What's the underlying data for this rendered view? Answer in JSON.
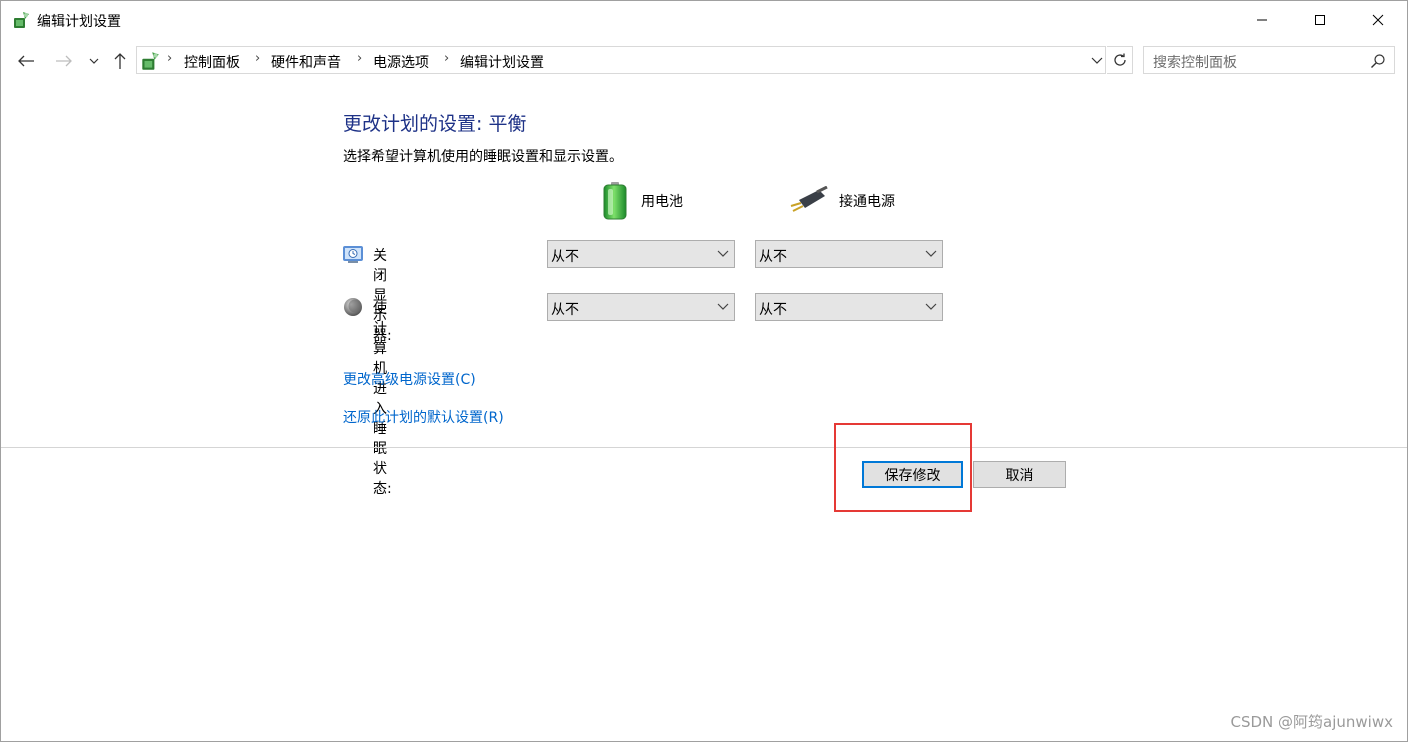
{
  "window": {
    "title": "编辑计划设置",
    "controls": {
      "minimize": "minimize-icon",
      "maximize": "maximize-icon",
      "close": "close-icon"
    }
  },
  "nav": {
    "breadcrumbs": [
      "控制面板",
      "硬件和声音",
      "电源选项",
      "编辑计划设置"
    ],
    "search_placeholder": "搜索控制面板"
  },
  "main": {
    "heading": "更改计划的设置: 平衡",
    "subheading": "选择希望计算机使用的睡眠设置和显示设置。",
    "columns": {
      "battery": "用电池",
      "plugged_in": "接通电源"
    },
    "settings": [
      {
        "label": "关闭显示器:",
        "battery": "从不",
        "plugged_in": "从不"
      },
      {
        "label": "使计算机进入睡眠状态:",
        "battery": "从不",
        "plugged_in": "从不"
      }
    ],
    "links": {
      "advanced": "更改高级电源设置(C)",
      "restore": "还原此计划的默认设置(R)"
    }
  },
  "footer": {
    "save": "保存修改",
    "cancel": "取消"
  },
  "watermark": "CSDN @阿筠ajunwiwx",
  "colors": {
    "heading": "#1e3287",
    "link": "#0066cc",
    "highlight": "#e53935",
    "focus_border": "#0078d7"
  }
}
